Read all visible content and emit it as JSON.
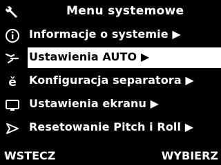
{
  "header": {
    "title": "Menu systemowe",
    "icon": "wrench-icon"
  },
  "menu": {
    "items": [
      {
        "label": "Informacje o systemie ▶",
        "icon": "info-icon",
        "selected": false
      },
      {
        "label": "Ustawienia AUTO ▶",
        "icon": "auto-steer-icon",
        "selected": true
      },
      {
        "label": "Konfiguracja separatora ▶",
        "icon": "separator-icon",
        "selected": false
      },
      {
        "label": "Ustawienia ekranu ▶",
        "icon": "monitor-icon",
        "selected": false
      },
      {
        "label": "Resetowanie Pitch i Roll ▶",
        "icon": "pitch-roll-icon",
        "selected": false
      }
    ]
  },
  "softkeys": {
    "left": "WSTECZ",
    "right": "WYBIERZ"
  },
  "colors": {
    "background": "#000000",
    "text": "#ffffff",
    "highlight": "#ffffff",
    "highlight_text": "#000000"
  }
}
